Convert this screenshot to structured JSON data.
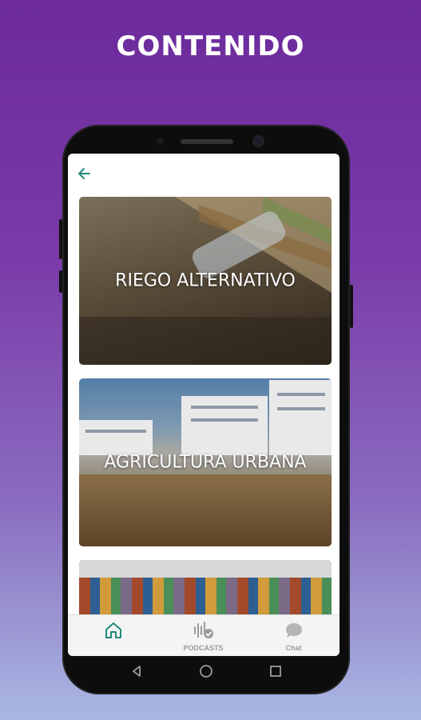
{
  "headline": "CONTENIDO",
  "cards": [
    {
      "title": "RIEGO ALTERNATIVO"
    },
    {
      "title": "AGRICULTURA URBANA"
    }
  ],
  "nav": {
    "home_label": "",
    "podcasts_label": "PODCASTS",
    "chat_label": "Chat"
  },
  "icons": {
    "back": "arrow-left-icon",
    "home": "home-icon",
    "podcasts": "podcast-icon",
    "chat": "chat-icon"
  },
  "colors": {
    "accent": "#1f8a7a",
    "background_top": "#6c2a9c",
    "background_bottom": "#a9b8e2"
  }
}
